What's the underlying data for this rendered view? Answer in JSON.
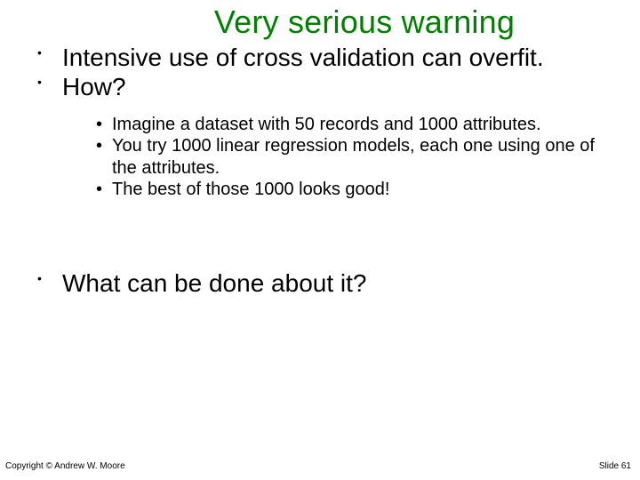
{
  "title": "Very serious warning",
  "bullets": {
    "b0": "Intensive use of cross validation can overfit.",
    "b1": "How?",
    "b2": "What can be done about it?"
  },
  "sub": {
    "s0": "Imagine a dataset with 50 records and 1000 attributes.",
    "s1": "You try 1000 linear regression models, each one using one of the attributes.",
    "s2": "The best of those 1000 looks good!"
  },
  "footer": {
    "copyright": "Copyright © Andrew W. Moore",
    "slide": "Slide 61"
  }
}
